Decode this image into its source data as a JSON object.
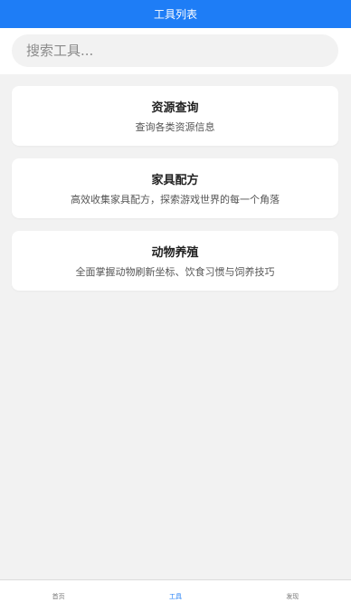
{
  "header": {
    "title": "工具列表"
  },
  "search": {
    "placeholder": "搜索工具..."
  },
  "tools": [
    {
      "title": "资源查询",
      "description": "查询各类资源信息"
    },
    {
      "title": "家具配方",
      "description": "高效收集家具配方，探索游戏世界的每一个角落"
    },
    {
      "title": "动物养殖",
      "description": "全面掌握动物刷新坐标、饮食习惯与饲养技巧"
    }
  ],
  "bottom_nav": {
    "items": [
      {
        "label": "首页"
      },
      {
        "label": "工具"
      },
      {
        "label": "发现"
      }
    ],
    "active": "工具"
  },
  "colors": {
    "accent": "#1e7df6",
    "background": "#f2f2f2",
    "card": "#ffffff"
  }
}
